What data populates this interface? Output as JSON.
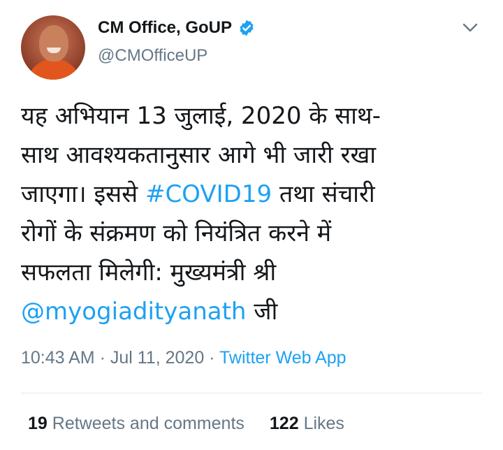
{
  "user": {
    "display_name": "CM Office, GoUP",
    "handle": "@CMOfficeUP",
    "verified": true
  },
  "tweet": {
    "lines": [
      {
        "pre": "यह अभियान 13 जुलाई, 2020 के साथ-"
      },
      {
        "pre": "साथ आवश्यकतानुसार आगे भी जारी रखा"
      },
      {
        "pre": "जाएगा। इससे ",
        "link": "#COVID19",
        "post": " तथा संचारी"
      },
      {
        "pre": "रोगों के संक्रमण को नियंत्रित करने में"
      },
      {
        "pre": "सफलता मिलेगी: मुख्यमंत्री श्री"
      },
      {
        "link": "@myogiadityanath",
        "post": " जी"
      }
    ]
  },
  "meta": {
    "time": "10:43 AM",
    "sep1": " · ",
    "date": "Jul 11, 2020",
    "sep2": " · ",
    "source": "Twitter Web App"
  },
  "stats": {
    "retweets_count": "19",
    "retweets_label": "Retweets and comments",
    "likes_count": "122",
    "likes_label": "Likes"
  },
  "colors": {
    "link": "#1da1f2",
    "secondary": "#657786",
    "primary": "#14171a",
    "divider": "#e1e8ed"
  },
  "icons": [
    "verified-badge-icon",
    "chevron-down-icon"
  ]
}
